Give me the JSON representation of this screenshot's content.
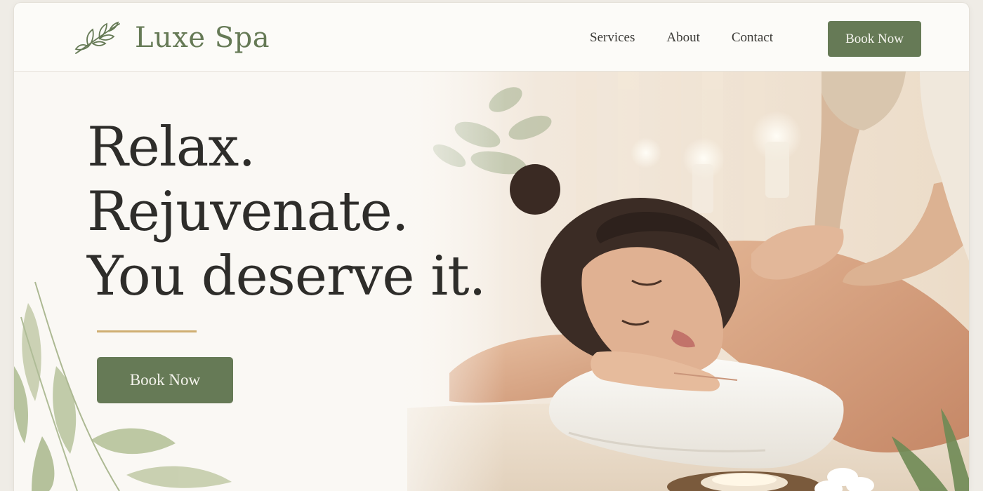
{
  "header": {
    "logo_text": "Luxe Spa",
    "logo_icon": "leaf-branch-icon",
    "nav": [
      {
        "label": "Services"
      },
      {
        "label": "About"
      },
      {
        "label": "Contact"
      }
    ],
    "cta_label": "Book Now"
  },
  "hero": {
    "headline_lines": [
      "Relax.",
      "Rejuvenate.",
      "You deserve it."
    ],
    "cta_label": "Book Now"
  },
  "colors": {
    "brand_green": "#667a56",
    "accent_gold": "#cfae72",
    "background": "#faf8f4",
    "text_dark": "#2e2d2a"
  }
}
